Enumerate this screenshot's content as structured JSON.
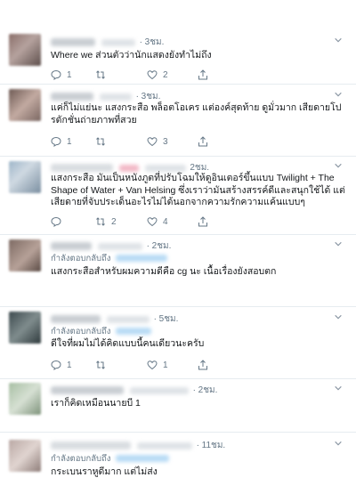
{
  "tweets": [
    {
      "time": "· 3ชม.",
      "reply_to": "",
      "text": "Where we ส่วนตัวว่านักแสดงยังทำไม่ถึง",
      "replies": "1",
      "retweets": "",
      "likes": "2"
    },
    {
      "time": "· 3ชม.",
      "reply_to": "",
      "text": "แค่ก็ไม่แย่นะ แสงกระสือ พล็อตโอเคร แต่องค์สุดท้าย ดูมั่วมาก เสียดายโปรดักชั่นถ่ายภาพที่สวย",
      "replies": "1",
      "retweets": "",
      "likes": "3"
    },
    {
      "time": "2ชม.",
      "reply_to": "",
      "text": "แสงกระสือ มันเป็นหนังภูตที่ปรับโฉมให้ดูอินเตอร์ขึ้นแบบ Twilight + The Shape of Water + Van Helsing ซึ่งเราว่ามันสร้างสรรค์ดีและสนุกใช้ได้ แต่เสียดายที่จับประเด็นอะไรไม่ได้นอกจากความรักความแค้นแบบๆ",
      "replies": "",
      "retweets": "2",
      "likes": "4"
    },
    {
      "time": "· 2ชม.",
      "reply_to": "กำลังตอบกลับถึง",
      "text": "แสงกระสือสำหรับผมความดีคือ cg นะ เนื้อเรื่องยังสอบตก",
      "replies": "",
      "retweets": "",
      "likes": ""
    },
    {
      "time": "· 5ชม.",
      "reply_to": "กำลังตอบกลับถึง",
      "text": "ดีใจที่ผมไม่ได้คิดแบบนี้คนเดียวนะครับ",
      "replies": "1",
      "retweets": "",
      "likes": "1"
    },
    {
      "time": "· 2ชม.",
      "reply_to": "",
      "text": "เราก็คิดเหมือนนายบี 1",
      "replies": "",
      "retweets": "",
      "likes": ""
    },
    {
      "time": "· 11ชม.",
      "reply_to": "กำลังตอบกลับถึง",
      "text": "กระเบนราหูดีมาก แต่ไม่ส่ง",
      "replies": "",
      "retweets": "",
      "likes": ""
    }
  ],
  "icons": {
    "reply": "reply-icon",
    "retweet": "retweet-icon",
    "like": "heart-icon",
    "share": "share-icon",
    "menu": "chevron-down-icon"
  },
  "colors": {
    "text": "#14171a",
    "secondary": "#657786",
    "divider": "#e6ecf0",
    "link": "#1da1f2"
  }
}
